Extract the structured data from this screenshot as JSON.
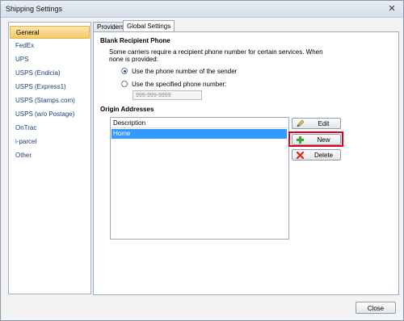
{
  "window": {
    "title": "Shipping Settings",
    "close_glyph": "✕"
  },
  "sidebar": {
    "items": [
      {
        "label": "General",
        "selected": true
      },
      {
        "label": "FedEx"
      },
      {
        "label": "UPS"
      },
      {
        "label": "USPS (Endicia)"
      },
      {
        "label": "USPS (Express1)"
      },
      {
        "label": "USPS (Stamps.com)"
      },
      {
        "label": "USPS (w/o Postage)"
      },
      {
        "label": "OnTrac"
      },
      {
        "label": "i-parcel"
      },
      {
        "label": "Other"
      }
    ]
  },
  "tabs": [
    {
      "label": "Providers",
      "active": false
    },
    {
      "label": "Global Settings",
      "active": true
    }
  ],
  "blank_phone": {
    "heading": "Blank Recipient Phone",
    "description_line1": "Some carriers require a recipient phone number for certain services.  When",
    "description_line2": "none is provided:",
    "option_sender": "Use the phone number of the sender",
    "option_specified": "Use the specified phone number:",
    "phone_value": "999-999-9999",
    "selected_option": "sender"
  },
  "origin": {
    "heading": "Origin Addresses",
    "column_header": "Description",
    "rows": [
      "Home"
    ],
    "buttons": {
      "edit": {
        "label": "Edit",
        "icon": "pencil-icon"
      },
      "new": {
        "label": "New",
        "icon": "plus-icon"
      },
      "delete": {
        "label": "Delete",
        "icon": "delete-x-icon"
      }
    }
  },
  "footer": {
    "close_label": "Close"
  },
  "colors": {
    "highlight": "#e0001b",
    "selection": "#3399ff",
    "sidebar_selected": "#f7c968"
  }
}
